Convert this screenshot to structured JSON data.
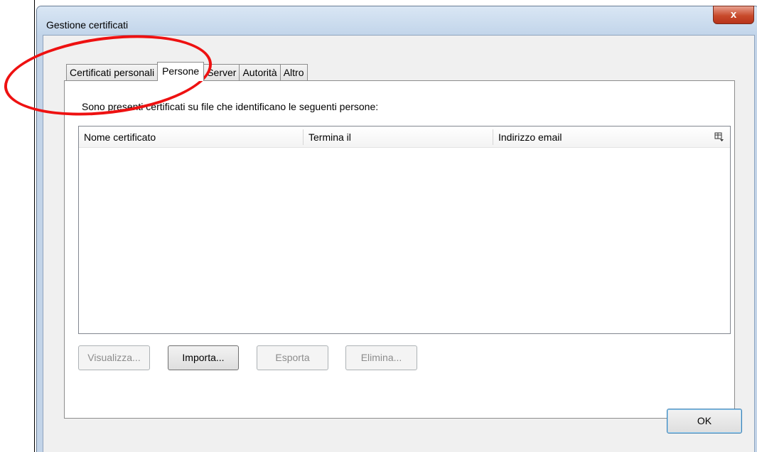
{
  "window": {
    "title": "Gestione certificati",
    "close_symbol": "x"
  },
  "tabs": [
    {
      "label": "Certificati personali",
      "active": false
    },
    {
      "label": "Persone",
      "active": true
    },
    {
      "label": "Server",
      "active": false
    },
    {
      "label": "Autorità",
      "active": false
    },
    {
      "label": "Altro",
      "active": false
    }
  ],
  "panel": {
    "description": "Sono presenti certificati su file che identificano le seguenti persone:",
    "columns": [
      "Nome certificato",
      "Termina il",
      "Indirizzo email"
    ],
    "rows": []
  },
  "buttons": {
    "view": "Visualizza...",
    "import": "Importa...",
    "export": "Esporta",
    "delete": "Elimina...",
    "ok": "OK"
  },
  "colors": {
    "window_frame": "#c3d4e8",
    "close_button": "#c84a2b",
    "annotation": "#ee1111"
  },
  "icons": [
    "close-icon",
    "column-picker-icon"
  ]
}
